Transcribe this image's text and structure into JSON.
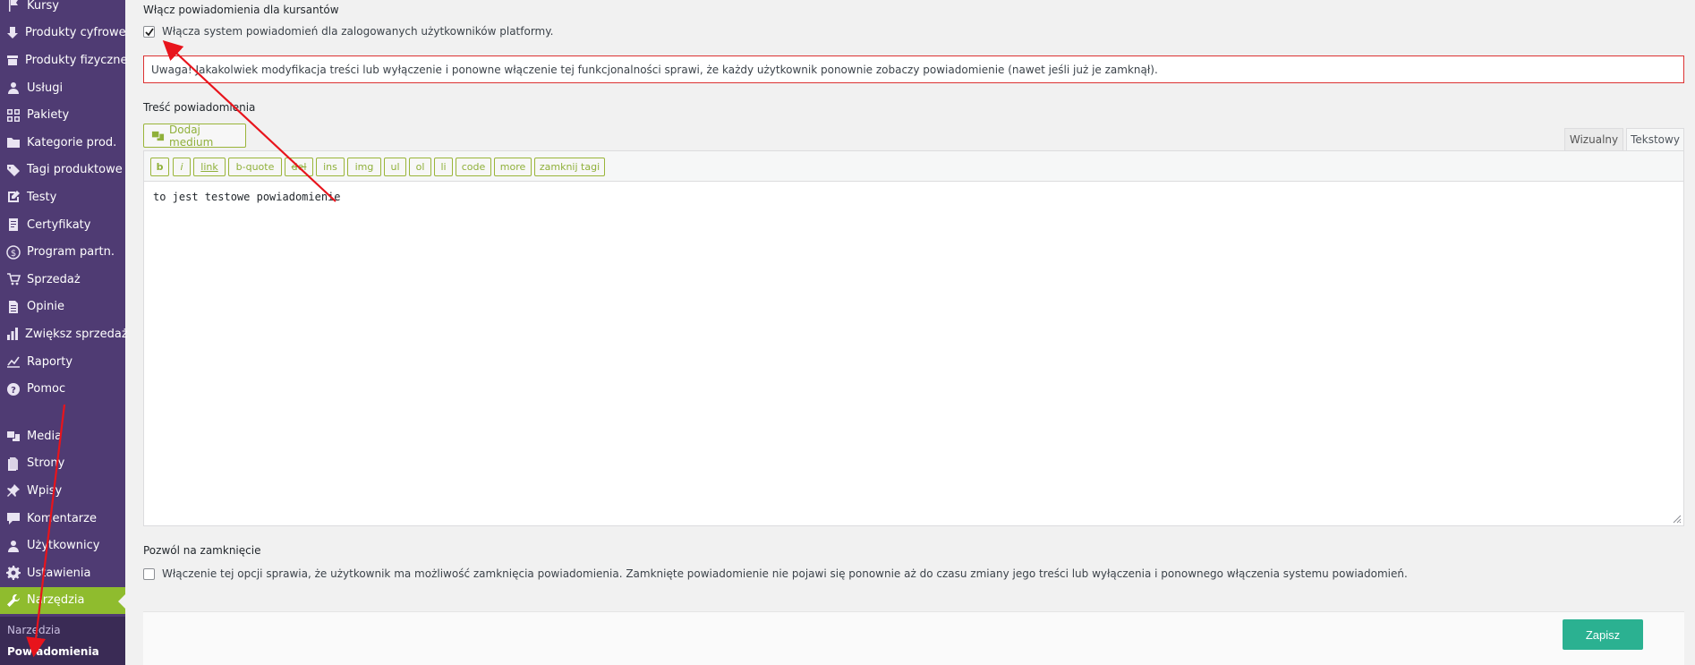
{
  "sidebar": {
    "items": [
      {
        "label": "Kursy",
        "icon": "flag-icon"
      },
      {
        "label": "Produkty cyfrowe",
        "icon": "download-icon"
      },
      {
        "label": "Produkty fizyczne",
        "icon": "box-icon"
      },
      {
        "label": "Usługi",
        "icon": "user-icon"
      },
      {
        "label": "Pakiety",
        "icon": "grid-icon"
      },
      {
        "label": "Kategorie prod.",
        "icon": "folder-icon"
      },
      {
        "label": "Tagi produktowe",
        "icon": "tag-icon"
      },
      {
        "label": "Testy",
        "icon": "edit-icon"
      },
      {
        "label": "Certyfikaty",
        "icon": "certificate-icon"
      },
      {
        "label": "Program partn.",
        "icon": "dollar-icon"
      },
      {
        "label": "Sprzedaż",
        "icon": "cart-icon"
      },
      {
        "label": "Opinie",
        "icon": "document-icon"
      },
      {
        "label": "Zwiększ sprzedaż",
        "icon": "bar-chart-icon"
      },
      {
        "label": "Raporty",
        "icon": "line-chart-icon"
      },
      {
        "label": "Pomoc",
        "icon": "help-icon"
      }
    ],
    "core_items": [
      {
        "label": "Media",
        "icon": "media-icon"
      },
      {
        "label": "Strony",
        "icon": "page-icon"
      },
      {
        "label": "Wpisy",
        "icon": "pin-icon"
      },
      {
        "label": "Komentarze",
        "icon": "comment-icon"
      },
      {
        "label": "Użytkownicy",
        "icon": "users-icon"
      },
      {
        "label": "Ustawienia",
        "icon": "settings-icon"
      },
      {
        "label": "Narzędzia",
        "icon": "wrench-icon",
        "active": true
      }
    ],
    "submenu": [
      {
        "label": "Narzędzia"
      },
      {
        "label": "Powiadomienia",
        "current": true
      }
    ]
  },
  "notifications": {
    "enable_title": "Włącz powiadomienia dla kursantów",
    "enable_checkbox_label": "Włącza system powiadomień dla zalogowanych użytkowników platformy.",
    "enable_checked": true,
    "warning": "Uwaga! Jakakolwiek modyfikacja treści lub wyłączenie i ponowne włączenie tej funkcjonalności sprawi, że każdy użytkownik ponownie zobaczy powiadomienie (nawet jeśli już je zamknął).",
    "content_title": "Treść powiadomienia",
    "add_media_label": "Dodaj medium",
    "tabs": {
      "visual": "Wizualny",
      "text": "Tekstowy",
      "active": "text"
    },
    "quicktags": [
      "b",
      "i",
      "link",
      "b-quote",
      "del",
      "ins",
      "img",
      "ul",
      "ol",
      "li",
      "code",
      "more",
      "zamknij tagi"
    ],
    "content_value": "to jest testowe powiadomienie",
    "allow_close_title": "Pozwól na zamknięcie",
    "allow_close_label": "Włączenie tej opcji sprawia, że użytkownik ma możliwość zamknięcia powiadomienia. Zamknięte powiadomienie nie pojawi się ponownie aż do czasu zmiany jego treści lub wyłączenia i ponownego włączenia systemu powiadomień.",
    "allow_close_checked": false,
    "save_label": "Zapisz"
  },
  "colors": {
    "sidebar_bg": "#4f3b73",
    "active_item": "#8fbc2e",
    "accent_green": "#8fb03a",
    "save_button": "#2bb191",
    "warning_border": "#dc3232",
    "annotation_arrow": "#e8141c"
  }
}
